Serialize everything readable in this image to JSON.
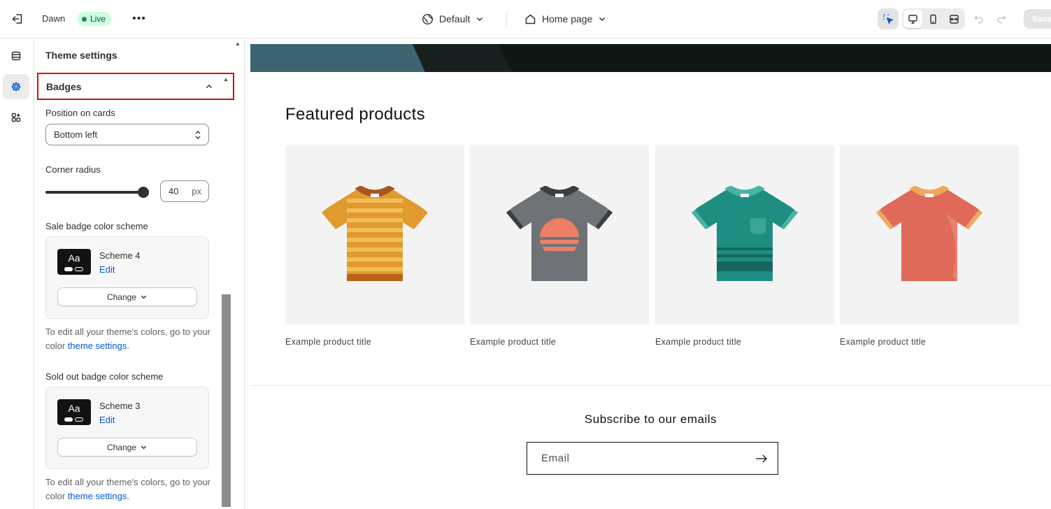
{
  "topbar": {
    "theme_name": "Dawn",
    "live_label": "Live",
    "more_label": "•••",
    "preset_label": "Default",
    "page_label": "Home page",
    "save_label": "Save"
  },
  "panel": {
    "title": "Theme settings",
    "section": "Badges",
    "position_label": "Position on cards",
    "position_value": "Bottom left",
    "radius_label": "Corner radius",
    "radius_value": "40",
    "radius_unit": "px",
    "radius_fraction": 1.0,
    "sale_label": "Sale badge color scheme",
    "sale_scheme": {
      "swatch": "Aa",
      "name": "Scheme 4",
      "edit": "Edit",
      "change": "Change"
    },
    "help1_prefix": "To edit all your theme's colors, go to your color",
    "help1_link": "theme settings",
    "help1_suffix": ".",
    "soldout_label": "Sold out badge color scheme",
    "soldout_scheme": {
      "swatch": "Aa",
      "name": "Scheme 3",
      "edit": "Edit",
      "change": "Change"
    },
    "help2_prefix": "To edit all your theme's colors, go to your color",
    "help2_link": "theme settings",
    "help2_suffix": "."
  },
  "preview": {
    "featured_title": "Featured products",
    "products": [
      {
        "title": "Example product title",
        "color": "orange-striped"
      },
      {
        "title": "Example product title",
        "color": "gray-sunset"
      },
      {
        "title": "Example product title",
        "color": "teal-pocket"
      },
      {
        "title": "Example product title",
        "color": "coral-plain"
      }
    ],
    "subscribe_title": "Subscribe to our emails",
    "email_placeholder": "Email"
  },
  "colors": {
    "accent_blue": "#005bd3",
    "highlight_red": "#c4161c",
    "live_bg": "#cdfee1"
  }
}
